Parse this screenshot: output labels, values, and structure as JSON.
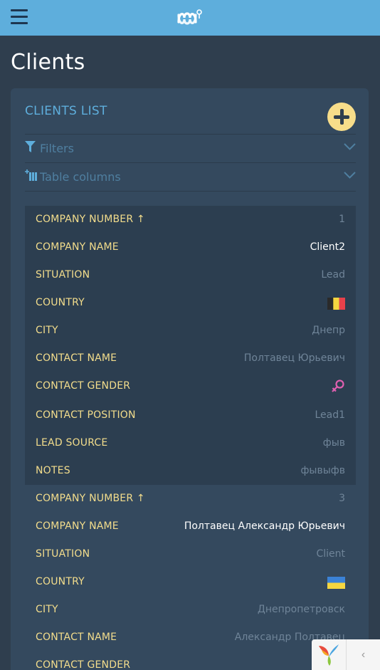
{
  "page": {
    "title": "Clients"
  },
  "panel": {
    "title": "CLIENTS LIST",
    "filters_label": "Filters",
    "columns_label": "Table columns"
  },
  "records": [
    {
      "company_number_label": "COMPANY NUMBER ↑",
      "company_number": "1",
      "company_name_label": "COMPANY NAME",
      "company_name": "Client2",
      "situation_label": "SITUATION",
      "situation": "Lead",
      "country_label": "COUNTRY",
      "country_flag": "belgium",
      "city_label": "CITY",
      "city": "Днепр",
      "contact_name_label": "CONTACT NAME",
      "contact_name": "Полтавец Юрьевич",
      "contact_gender_label": "CONTACT GENDER",
      "contact_gender": "female-icon",
      "contact_position_label": "CONTACT POSITION",
      "contact_position": "Lead1",
      "lead_source_label": "LEAD SOURCE",
      "lead_source": "фыв",
      "notes_label": "NOTES",
      "notes": "фывыфв"
    },
    {
      "company_number_label": "COMPANY NUMBER ↑",
      "company_number": "3",
      "company_name_label": "COMPANY NAME",
      "company_name": "Полтавец Александр Юрьевич",
      "situation_label": "SITUATION",
      "situation": "Client",
      "country_label": "COUNTRY",
      "country_flag": "ukraine",
      "city_label": "CITY",
      "city": "Днепропетровск",
      "contact_name_label": "CONTACT NAME",
      "contact_name": "Александр Полтавец",
      "contact_gender_label": "CONTACT GENDER"
    }
  ],
  "colors": {
    "topbar": "#5eaedc",
    "accent_yellow": "#f3dd8c",
    "gender_female": "#e060b0"
  }
}
